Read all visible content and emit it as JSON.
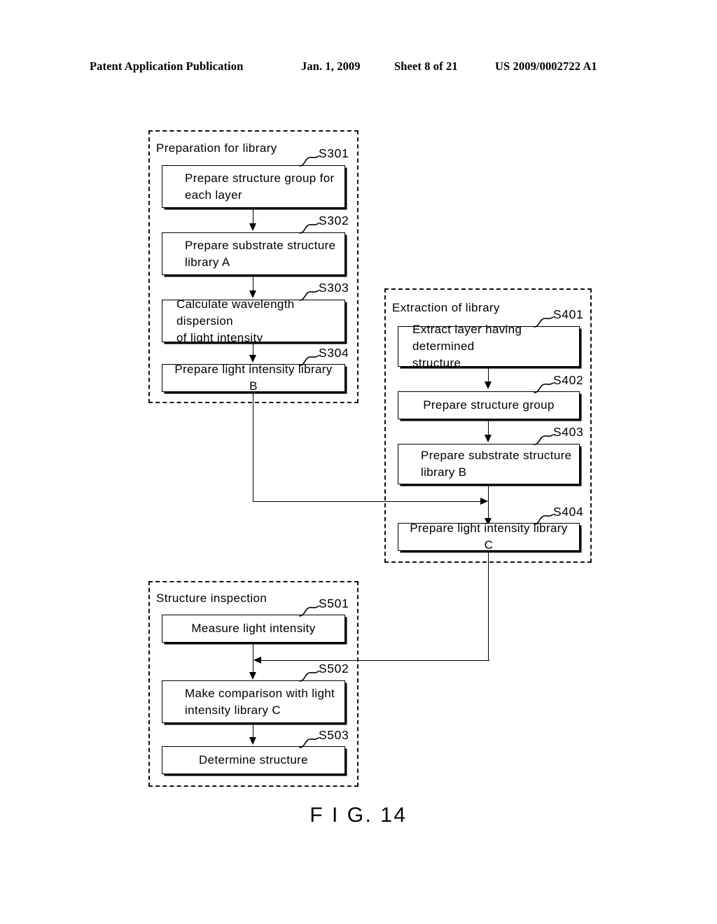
{
  "header": {
    "publication": "Patent Application Publication",
    "date": "Jan. 1, 2009",
    "sheet": "Sheet 8 of 21",
    "number": "US 2009/0002722 A1"
  },
  "figure": {
    "caption": "F I G. 14"
  },
  "groups": {
    "preparation": {
      "title": "Preparation for library"
    },
    "extraction": {
      "title": "Extraction of library"
    },
    "inspection": {
      "title": "Structure inspection"
    }
  },
  "steps": {
    "s301": {
      "id": "S301",
      "text": "Prepare structure group for\neach layer"
    },
    "s302": {
      "id": "S302",
      "text": "Prepare substrate structure\nlibrary A"
    },
    "s303": {
      "id": "S303",
      "text": "Calculate wavelength dispersion\nof light intensity"
    },
    "s304": {
      "id": "S304",
      "text": "Prepare light intensity library B"
    },
    "s401": {
      "id": "S401",
      "text": "Extract layer having determined\nstructure"
    },
    "s402": {
      "id": "S402",
      "text": "Prepare structure group"
    },
    "s403": {
      "id": "S403",
      "text": "Prepare substrate structure\nlibrary B"
    },
    "s404": {
      "id": "S404",
      "text": "Prepare light intensity library C"
    },
    "s501": {
      "id": "S501",
      "text": "Measure light intensity"
    },
    "s502": {
      "id": "S502",
      "text": "Make comparison with light\nintensity library C"
    },
    "s503": {
      "id": "S503",
      "text": "Determine structure"
    }
  }
}
